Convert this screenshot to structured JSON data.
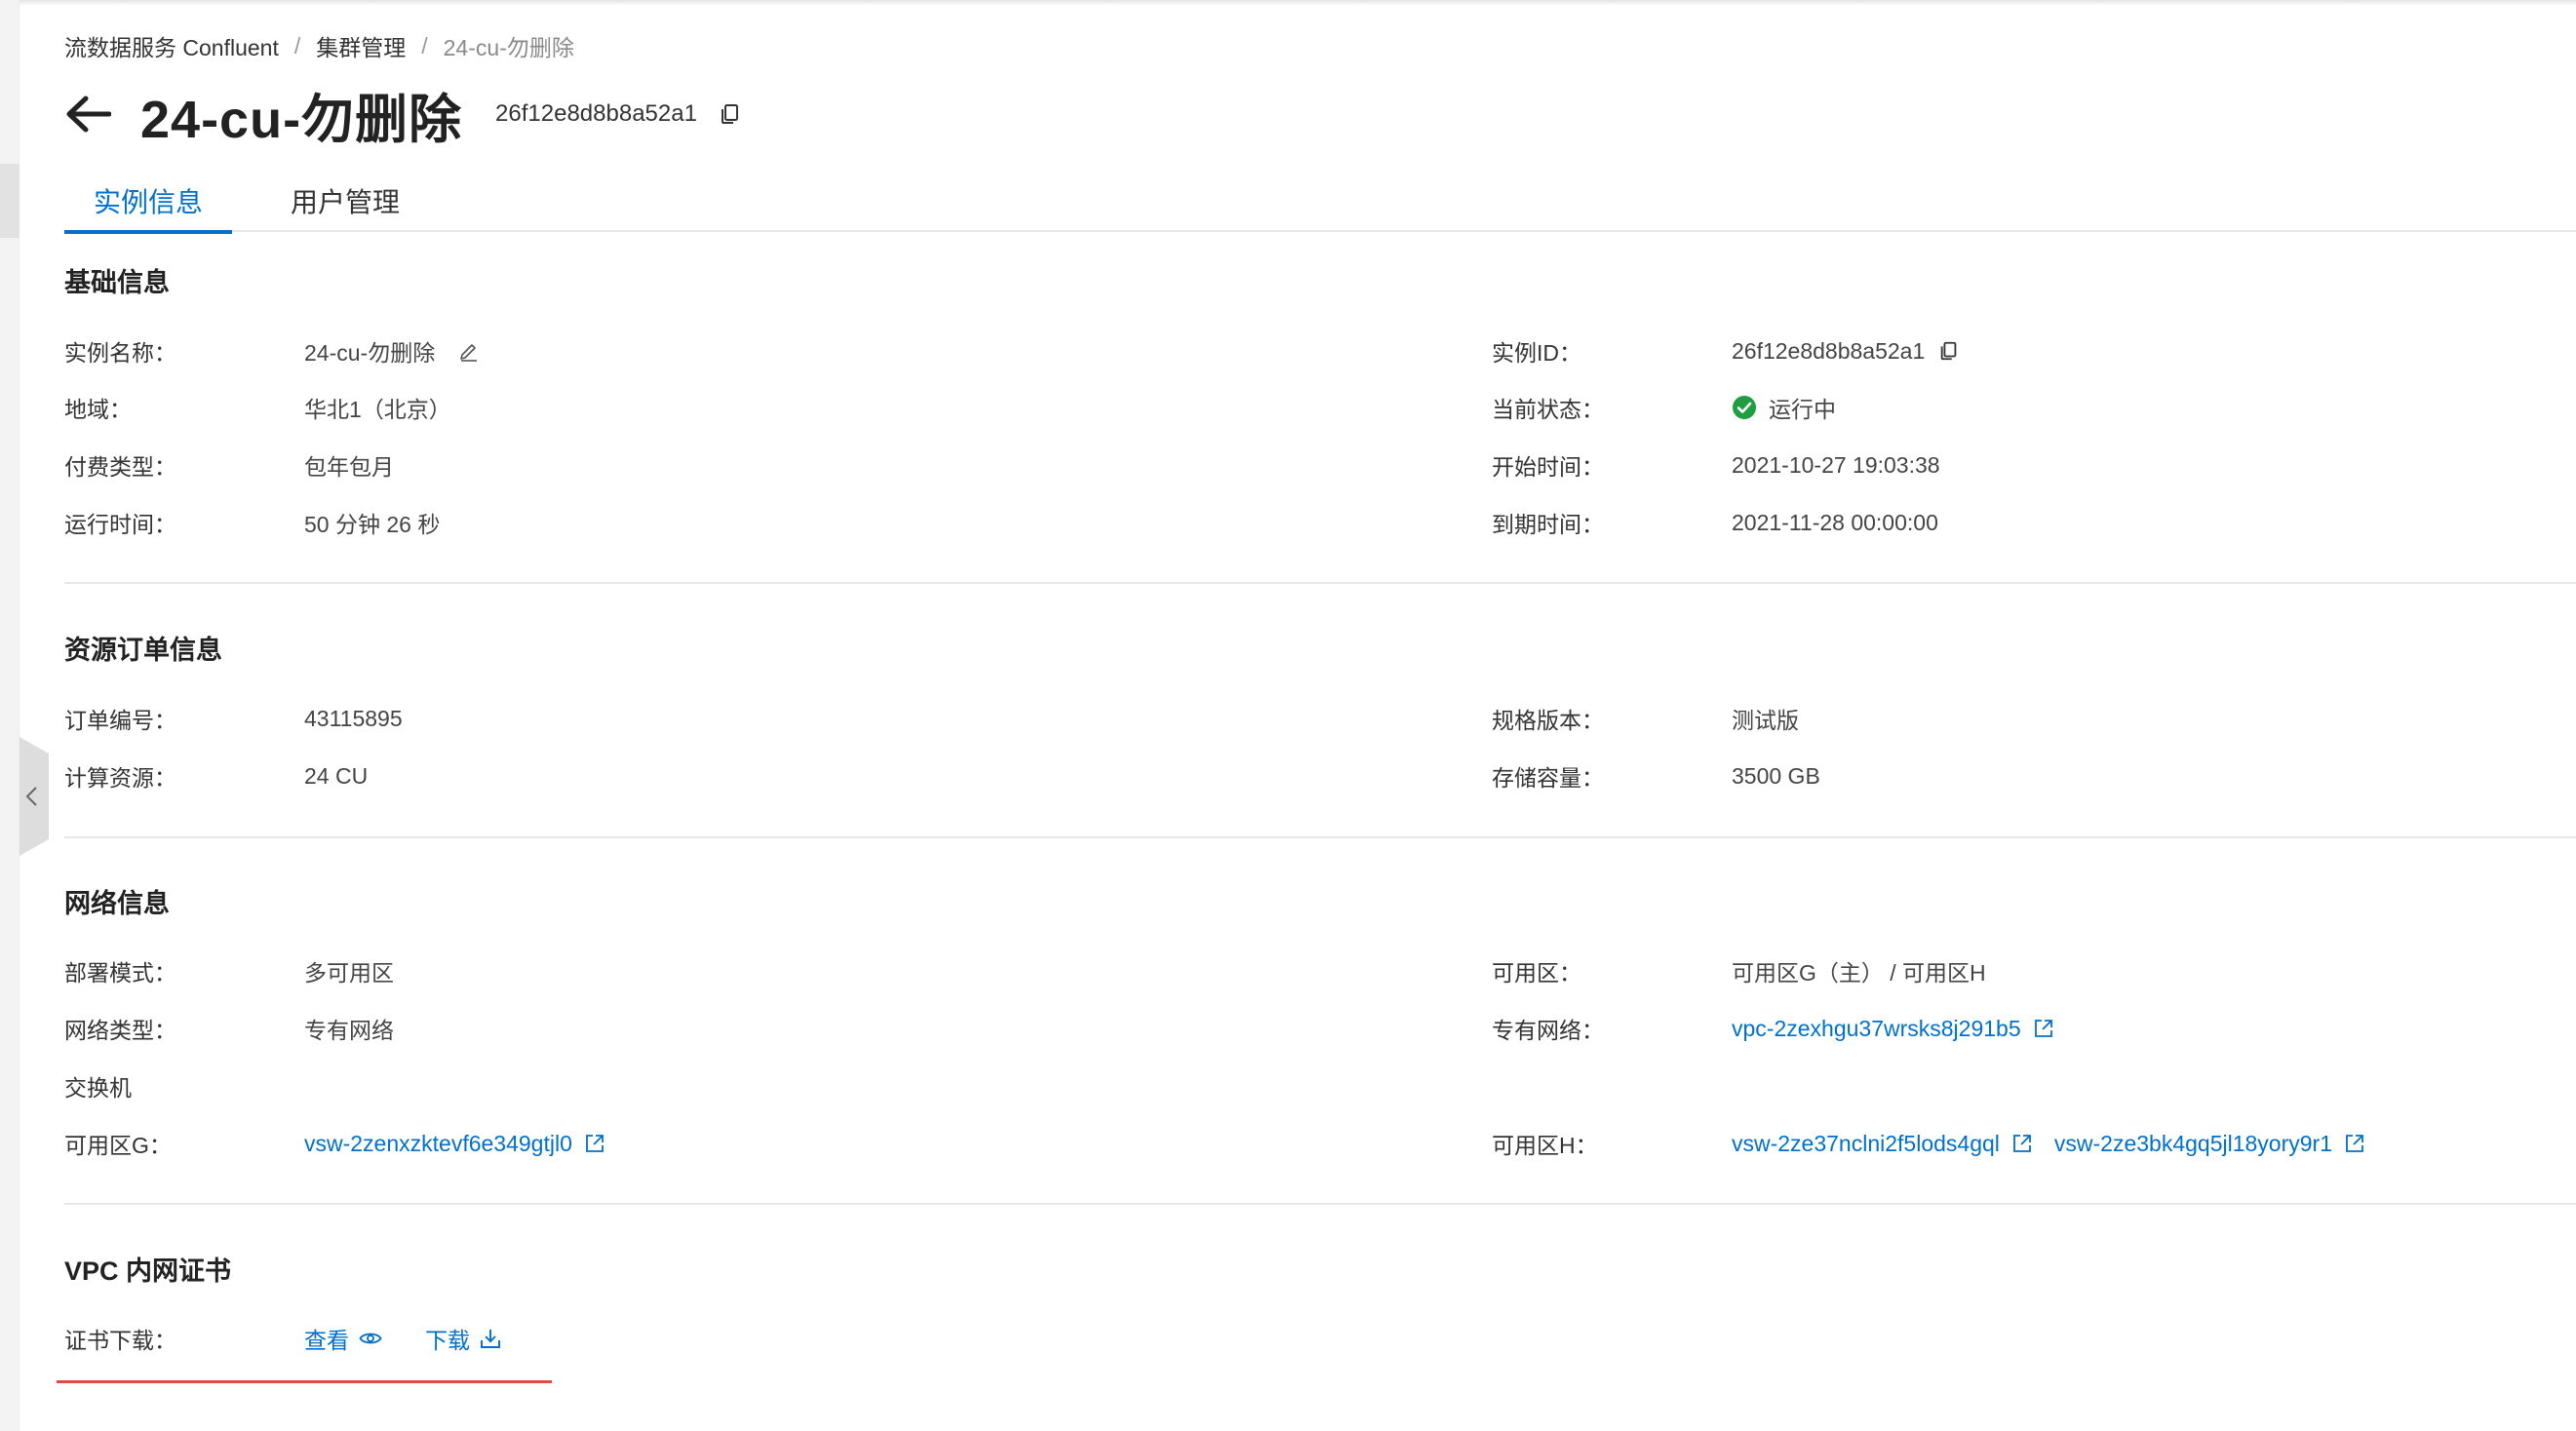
{
  "breadcrumb": [
    "流数据服务 Confluent",
    "集群管理",
    "24-cu-勿删除"
  ],
  "header": {
    "title": "24-cu-勿删除",
    "instance_id": "26f12e8d8b8a52a1"
  },
  "tabs": [
    {
      "label": "实例信息",
      "active": true
    },
    {
      "label": "用户管理",
      "active": false
    }
  ],
  "basic": {
    "title": "基础信息",
    "left": [
      {
        "label": "实例名称：",
        "value": "24-cu-勿删除"
      },
      {
        "label": "地域：",
        "value": "华北1（北京）"
      },
      {
        "label": "付费类型：",
        "value": "包年包月"
      },
      {
        "label": "运行时间：",
        "value": "50 分钟 26 秒"
      }
    ],
    "right": [
      {
        "label": "实例ID：",
        "value": "26f12e8d8b8a52a1"
      },
      {
        "label": "当前状态：",
        "value": "运行中"
      },
      {
        "label": "开始时间：",
        "value": "2021-10-27 19:03:38"
      },
      {
        "label": "到期时间：",
        "value": "2021-11-28 00:00:00"
      }
    ]
  },
  "order": {
    "title": "资源订单信息",
    "left": [
      {
        "label": "订单编号：",
        "value": "43115895"
      },
      {
        "label": "计算资源：",
        "value": "24 CU"
      }
    ],
    "right": [
      {
        "label": "规格版本：",
        "value": "测试版"
      },
      {
        "label": "存储容量：",
        "value": "3500 GB"
      }
    ]
  },
  "network": {
    "title": "网络信息",
    "deploy_label": "部署模式：",
    "deploy_value": "多可用区",
    "nettype_label": "网络类型：",
    "nettype_value": "专有网络",
    "zone_label": "可用区：",
    "zone_value": "可用区G（主） / 可用区H",
    "vpc_label": "专有网络：",
    "vpc_value": "vpc-2zexhgu37wrsks8j291b5",
    "switch_heading": "交换机",
    "zone_g_label": "可用区G：",
    "zone_g_value": "vsw-2zenxzktevf6e349gtjl0",
    "zone_h_label": "可用区H：",
    "zone_h_values": [
      "vsw-2ze37nclni2f5lods4gql",
      "vsw-2ze3bk4gq5jl18yory9r1"
    ]
  },
  "cert": {
    "title": "VPC 内网证书",
    "label": "证书下载：",
    "view_label": "查看",
    "download_label": "下载"
  },
  "colors": {
    "accent": "#0070cc",
    "status_ok": "#1e9e41",
    "highlight_line": "#e5483f"
  },
  "icons": [
    "back-arrow-icon",
    "copy-icon",
    "edit-icon",
    "check-circle-icon",
    "external-link-icon",
    "eye-icon",
    "download-icon",
    "chevron-left-icon"
  ]
}
